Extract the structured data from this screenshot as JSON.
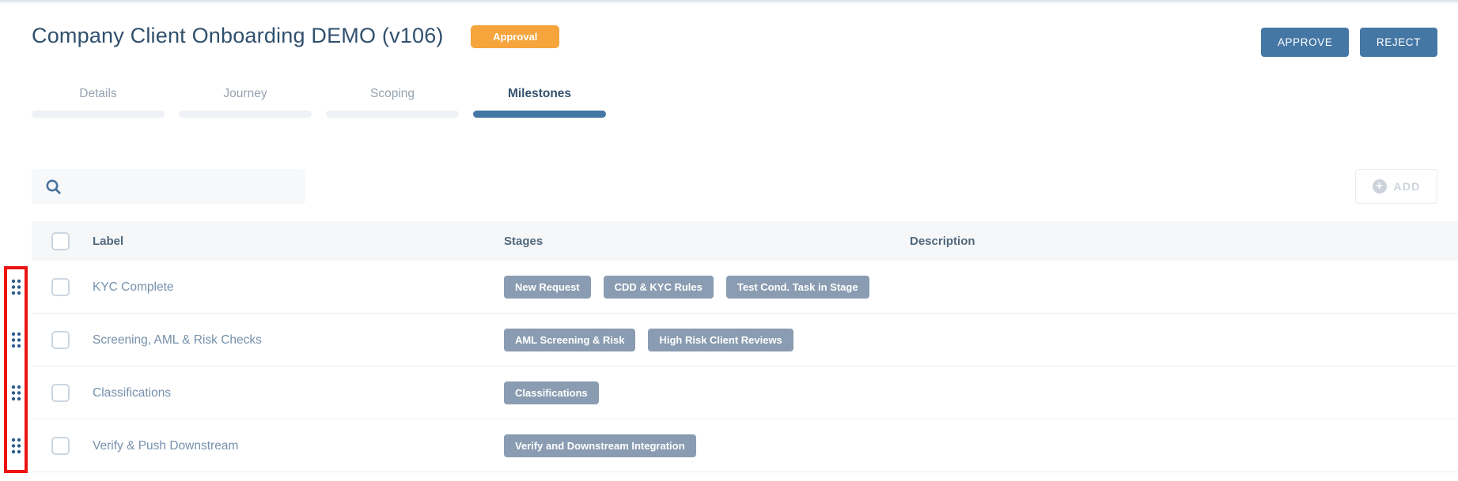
{
  "header": {
    "title": "Company Client Onboarding DEMO (v106)",
    "status_badge": "Approval",
    "approve_label": "APPROVE",
    "reject_label": "REJECT"
  },
  "tabs": [
    {
      "label": "Details",
      "active": false
    },
    {
      "label": "Journey",
      "active": false
    },
    {
      "label": "Scoping",
      "active": false
    },
    {
      "label": "Milestones",
      "active": true
    }
  ],
  "toolbar": {
    "search_placeholder": "",
    "search_value": "",
    "add_label": "ADD"
  },
  "table": {
    "columns": {
      "label": "Label",
      "stages": "Stages",
      "description": "Description"
    },
    "rows": [
      {
        "label": "KYC Complete",
        "stages": [
          "New Request",
          "CDD & KYC Rules",
          "Test Cond. Task in Stage"
        ],
        "description": ""
      },
      {
        "label": "Screening, AML & Risk Checks",
        "stages": [
          "AML Screening & Risk",
          "High Risk Client Reviews"
        ],
        "description": ""
      },
      {
        "label": "Classifications",
        "stages": [
          "Classifications"
        ],
        "description": ""
      },
      {
        "label": "Verify & Push Downstream",
        "stages": [
          "Verify and Downstream Integration"
        ],
        "description": ""
      }
    ]
  },
  "colors": {
    "accent-orange": "#f6a43c",
    "btn-blue": "#4577a5",
    "stage-badge": "#8a9cb1",
    "annotation-red": "#ec1212",
    "dot-blue": "#2d5c8e"
  }
}
